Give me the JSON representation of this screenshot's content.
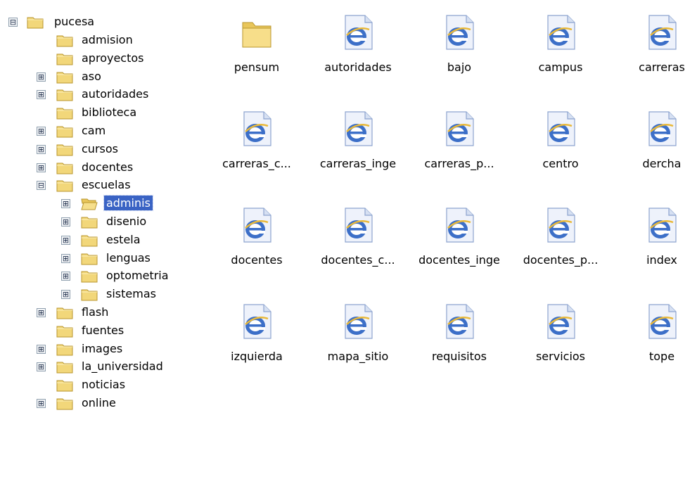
{
  "tree": {
    "root": {
      "label": "pucesa",
      "toggle": "⊟"
    },
    "items": [
      {
        "label": "admision",
        "toggle": ""
      },
      {
        "label": "aproyectos",
        "toggle": ""
      },
      {
        "label": "aso",
        "toggle": "⊞"
      },
      {
        "label": "autoridades",
        "toggle": "⊞"
      },
      {
        "label": "biblioteca",
        "toggle": ""
      },
      {
        "label": "cam",
        "toggle": "⊞"
      },
      {
        "label": "cursos",
        "toggle": "⊞"
      },
      {
        "label": "docentes",
        "toggle": "⊞"
      },
      {
        "label": "escuelas",
        "toggle": "⊟"
      },
      {
        "label": "adminis",
        "toggle": "⊞"
      },
      {
        "label": "disenio",
        "toggle": "⊞"
      },
      {
        "label": "estela",
        "toggle": "⊞"
      },
      {
        "label": "lenguas",
        "toggle": "⊞"
      },
      {
        "label": "optometria",
        "toggle": "⊞"
      },
      {
        "label": "sistemas",
        "toggle": "⊞"
      },
      {
        "label": "flash",
        "toggle": "⊞"
      },
      {
        "label": "fuentes",
        "toggle": ""
      },
      {
        "label": "images",
        "toggle": "⊞"
      },
      {
        "label": "la_universidad",
        "toggle": "⊞"
      },
      {
        "label": "noticias",
        "toggle": ""
      },
      {
        "label": "online",
        "toggle": "⊞"
      }
    ],
    "selected": "adminis"
  },
  "files": [
    {
      "name": "pensum",
      "icon": "folder-icon"
    },
    {
      "name": "autoridades",
      "icon": "ie-html-icon"
    },
    {
      "name": "bajo",
      "icon": "ie-html-icon"
    },
    {
      "name": "campus",
      "icon": "ie-html-icon"
    },
    {
      "name": "carreras",
      "icon": "ie-html-icon"
    },
    {
      "name": "carreras_c...",
      "icon": "ie-html-icon"
    },
    {
      "name": "carreras_inge",
      "icon": "ie-html-icon"
    },
    {
      "name": "carreras_p...",
      "icon": "ie-html-icon"
    },
    {
      "name": "centro",
      "icon": "ie-html-icon"
    },
    {
      "name": "dercha",
      "icon": "ie-html-icon"
    },
    {
      "name": "docentes",
      "icon": "ie-html-icon"
    },
    {
      "name": "docentes_c...",
      "icon": "ie-html-icon"
    },
    {
      "name": "docentes_inge",
      "icon": "ie-html-icon"
    },
    {
      "name": "docentes_p...",
      "icon": "ie-html-icon"
    },
    {
      "name": "index",
      "icon": "ie-html-icon"
    },
    {
      "name": "izquierda",
      "icon": "ie-html-icon"
    },
    {
      "name": "mapa_sitio",
      "icon": "ie-html-icon"
    },
    {
      "name": "requisitos",
      "icon": "ie-html-icon"
    },
    {
      "name": "servicios",
      "icon": "ie-html-icon"
    },
    {
      "name": "tope",
      "icon": "ie-html-icon"
    }
  ],
  "colors": {
    "selection": "#3a63c4",
    "folder": "#f2d77a",
    "ie_blue": "#3c6fc8"
  }
}
